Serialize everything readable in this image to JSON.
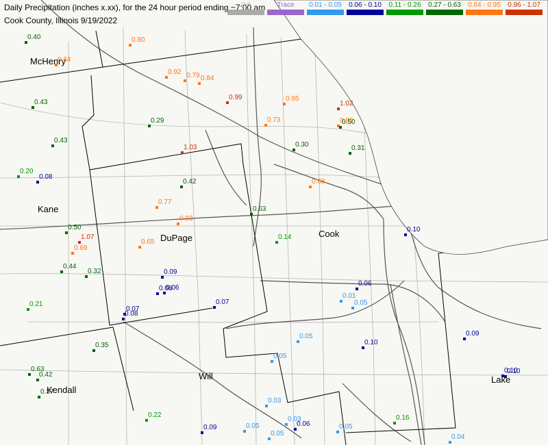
{
  "header": {
    "title": "Daily Precipitation (inches  x.xx),  for the 24 hour period ending ~7:00 am",
    "subtitle": "Cook County, Illinois  9/19/2022"
  },
  "legend": [
    {
      "label": "0.0",
      "color": "#aaaaaa",
      "text_color": "#bbbbbb"
    },
    {
      "label": "Trace",
      "color": "#9966cc",
      "text_color": "#9966cc"
    },
    {
      "label": "0.01 - 0.05",
      "color": "#3399ee",
      "text_color": "#3399ee"
    },
    {
      "label": "0.06 - 0.10",
      "color": "#000099",
      "text_color": "#000099"
    },
    {
      "label": "0.11 - 0.26",
      "color": "#009900",
      "text_color": "#009900"
    },
    {
      "label": "0.27 - 0.63",
      "color": "#006600",
      "text_color": "#006600"
    },
    {
      "label": "0.64 - 0.95",
      "color": "#ff7711",
      "text_color": "#ff7711"
    },
    {
      "label": "0.96 - 1.07",
      "color": "#cc3300",
      "text_color": "#cc3300"
    }
  ],
  "counties": [
    "McHenry",
    "Kane",
    "DuPage",
    "Cook",
    "Will",
    "Kendall",
    "Lake"
  ],
  "stations": [
    "0.40",
    "0.84",
    "0.80",
    "0.92",
    "0.79",
    "0.84",
    "0.99",
    "0.95",
    "1.02",
    "0.43",
    "0.29",
    "0.73",
    "0.85",
    "0.50",
    "0.43",
    "0.30",
    "0.31",
    "1.03",
    "0.20",
    "0.08",
    "0.42",
    "0.68",
    "0.77",
    "0.63",
    "0.93",
    "0.50",
    "1.07",
    "0.65",
    "0.14",
    "0.10",
    "0.69",
    "0.44",
    "0.32",
    "0.09",
    "0.08",
    "0.06",
    "0.07",
    "0.21",
    "0.07",
    "0.08",
    "0.06",
    "0.01",
    "0.05",
    "0.05",
    "0.10",
    "0.09",
    "0.35",
    "0.05",
    "0.63",
    "0.42",
    "0.10",
    "0.10",
    "0.37",
    "0.03",
    "0.22",
    "0.16",
    "0.09",
    "0.05",
    "0.05",
    "0.03",
    "0.06",
    "0.05",
    "0.04"
  ]
}
